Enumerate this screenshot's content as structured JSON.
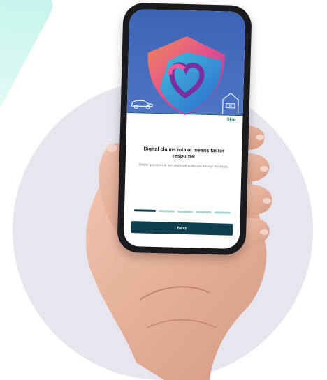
{
  "onboarding": {
    "skip_label": "Skip",
    "title": "Digital claims intake means faster response",
    "subtitle": "Simple questions in four steps will guide you through the intake",
    "steps_total": 5,
    "current_step": 1,
    "next_label": "Next"
  },
  "colors": {
    "hero_blue": "#3e63b5",
    "primary_dark": "#0f3f4f",
    "step_inactive": "#a9d9d5",
    "skip_teal": "#0f6a64",
    "circle_bg": "#e7e6ef"
  },
  "icons": [
    "shield-heart-logo",
    "car-icon",
    "house-icon"
  ]
}
